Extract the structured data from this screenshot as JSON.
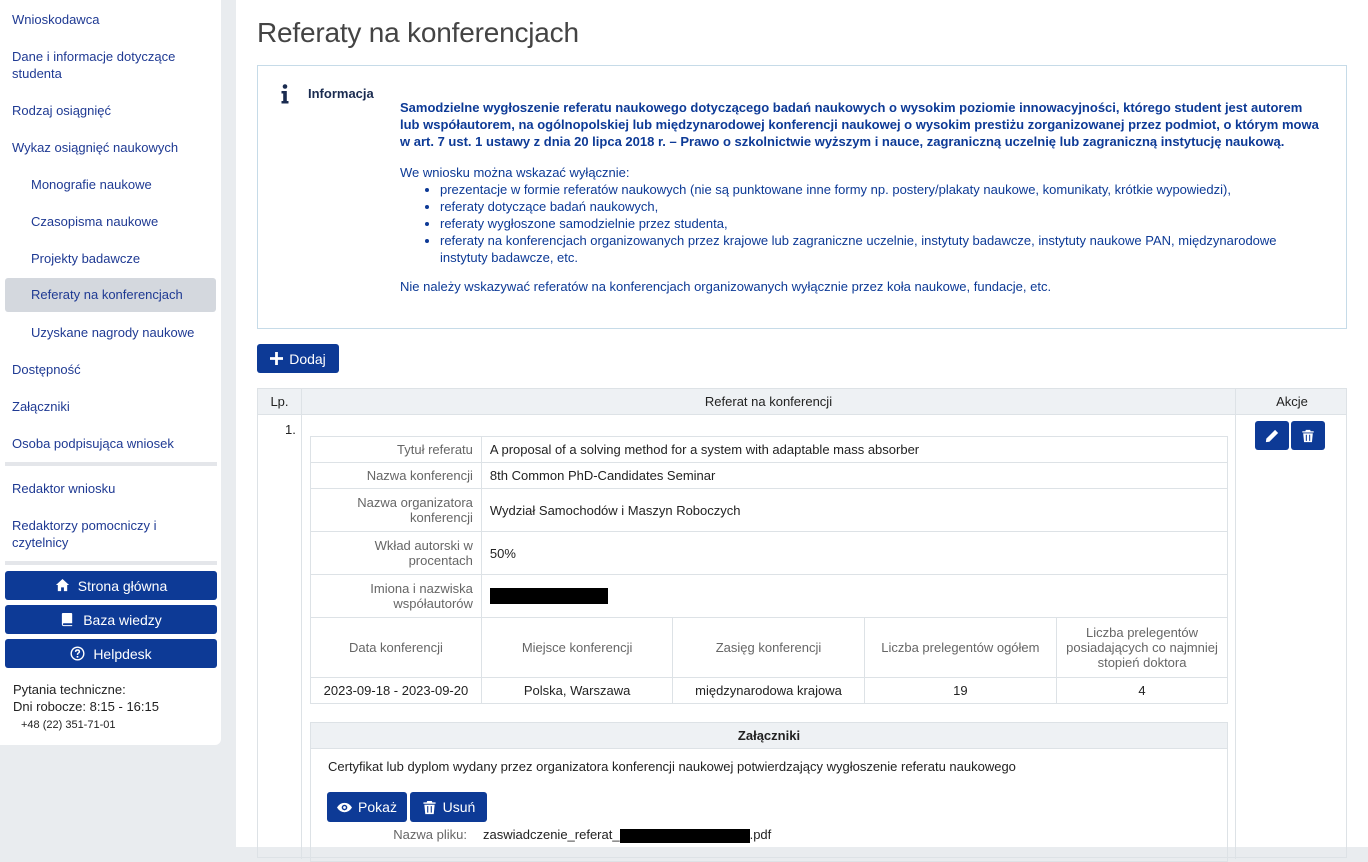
{
  "sidebar": {
    "nav": [
      {
        "label": "Wnioskodawca"
      },
      {
        "label": "Dane i informacje dotyczące studenta"
      },
      {
        "label": "Rodzaj osiągnięć"
      },
      {
        "label": "Wykaz osiągnięć naukowych"
      },
      {
        "label": "Monografie naukowe"
      },
      {
        "label": "Czasopisma naukowe"
      },
      {
        "label": "Projekty badawcze"
      },
      {
        "label": "Referaty na konferencjach"
      },
      {
        "label": "Uzyskane nagrody naukowe"
      },
      {
        "label": "Dostępność"
      },
      {
        "label": "Załączniki"
      },
      {
        "label": "Osoba podpisująca wniosek"
      },
      {
        "label": "Redaktor wniosku"
      },
      {
        "label": "Redaktorzy pomocniczy i czytelnicy"
      }
    ],
    "buttons": {
      "home": "Strona główna",
      "knowledge": "Baza wiedzy",
      "helpdesk": "Helpdesk"
    },
    "contact": {
      "line1": "Pytania techniczne:",
      "line2": "Dni robocze: 8:15 - 16:15",
      "phone": "+48 (22) 351-71-01"
    }
  },
  "main": {
    "title": "Referaty na konferencjach",
    "info": {
      "label": "Informacja",
      "bold": "Samodzielne wygłoszenie referatu naukowego dotyczącego badań naukowych o wysokim poziomie innowacyjności, którego student jest autorem lub współautorem, na ogólnopolskiej lub międzynarodowej konferencji naukowej o wysokim prestiżu zorganizowanej przez podmiot, o którym mowa w art. 7 ust. 1 ustawy z dnia 20 lipca 2018 r. – Prawo o szkolnictwie wyższym i nauce, zagraniczną uczelnię lub zagraniczną instytucję naukową.",
      "intro": "We wniosku można wskazać wyłącznie:",
      "items": [
        "prezentacje w formie referatów naukowych (nie są punktowane inne formy np. postery/plakaty naukowe, komunikaty, krótkie wypowiedzi),",
        "referaty dotyczące badań naukowych,",
        "referaty wygłoszone samodzielnie przez studenta,",
        "referaty na konferencjach organizowanych przez krajowe lub zagraniczne uczelnie, instytuty badawcze, instytuty naukowe PAN, międzynarodowe instytuty badawcze, etc."
      ],
      "footer": "Nie należy wskazywać referatów na konferencjach organizowanych wyłącznie przez koła naukowe, fundacje, etc."
    },
    "add_label": "Dodaj",
    "table": {
      "headers": {
        "lp": "Lp.",
        "referat": "Referat na konferencji",
        "akcje": "Akcje"
      },
      "row": {
        "lp": "1.",
        "fields": {
          "title_label": "Tytuł referatu",
          "title_value": "A proposal of a solving method for a system with adaptable mass absorber",
          "conf_label": "Nazwa konferencji",
          "conf_value": "8th Common PhD-Candidates Seminar",
          "org_label": "Nazwa organizatora konferencji",
          "org_value": "Wydział Samochodów i Maszyn Roboczych",
          "contrib_label": "Wkład autorski w procentach",
          "contrib_value": "50%",
          "coauthors_label": "Imiona i nazwiska współautorów"
        },
        "sub_headers": [
          "Data konferencji",
          "Miejsce konferencji",
          "Zasięg konferencji",
          "Liczba prelegentów ogółem",
          "Liczba prelegentów posiadających co najmniej stopień doktora"
        ],
        "sub_values": [
          "2023-09-18 - 2023-09-20",
          "Polska, Warszawa",
          "międzynarodowa krajowa",
          "19",
          "4"
        ],
        "attachments": {
          "title": "Załączniki",
          "desc": "Certyfikat lub dyplom wydany przez organizatora konferencji naukowej potwierdzający wygłoszenie referatu naukowego",
          "show": "Pokaż",
          "delete": "Usuń",
          "file_label": "Nazwa pliku:",
          "file_prefix": "zaswiadczenie_referat_",
          "file_suffix": ".pdf"
        }
      }
    }
  }
}
